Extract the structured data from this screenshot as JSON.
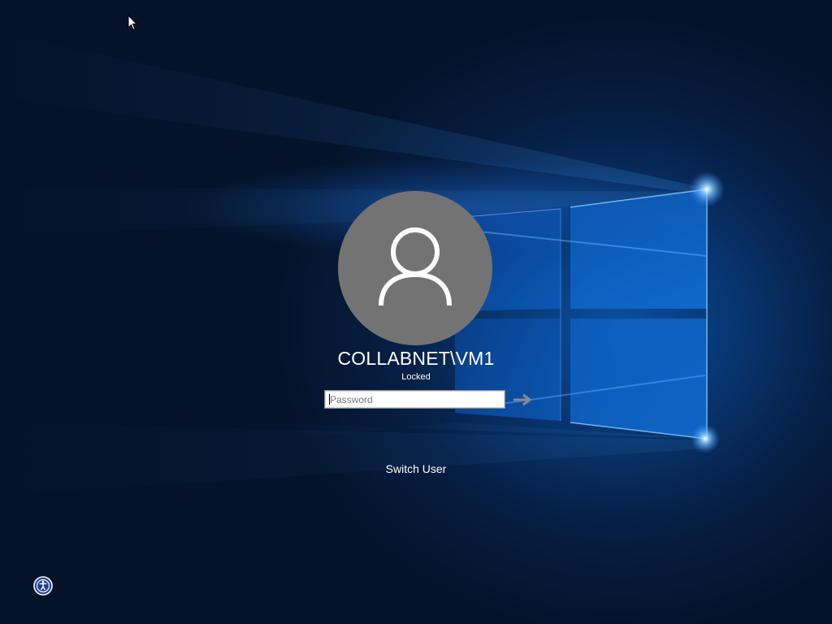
{
  "user": {
    "name": "COLLABNET\\VM1",
    "status": "Locked"
  },
  "login": {
    "password_placeholder": "Password",
    "password_value": ""
  },
  "actions": {
    "switch_user_label": "Switch User"
  },
  "icons": {
    "avatar": "user-silhouette-icon",
    "submit": "arrow-right-icon",
    "ease_of_access": "ease-of-access-icon",
    "cursor": "mouse-pointer-icon"
  },
  "colors": {
    "background": "#061f44",
    "avatar_bg": "#737373",
    "text": "#ffffff",
    "logo_glow": "#2a8cff"
  }
}
